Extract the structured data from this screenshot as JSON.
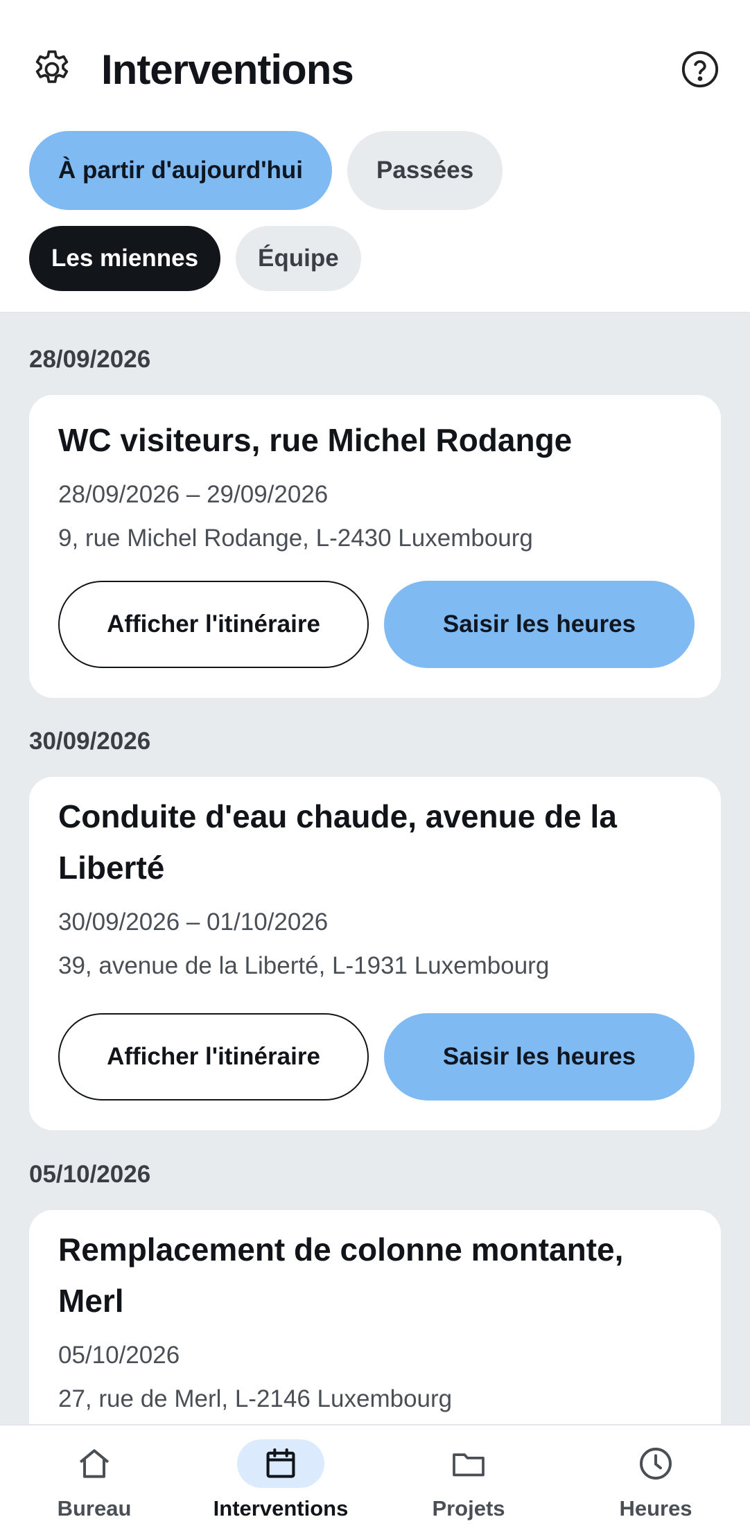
{
  "header": {
    "title": "Interventions",
    "settings_icon": "gear-icon",
    "help_icon": "help-circle-icon"
  },
  "filters": {
    "time": [
      {
        "label": "À partir d'aujourd'hui",
        "active": true
      },
      {
        "label": "Passées",
        "active": false
      }
    ],
    "scope": [
      {
        "label": "Les miennes",
        "active": true
      },
      {
        "label": "Équipe",
        "active": false
      }
    ]
  },
  "groups": [
    {
      "date": "28/09/2026",
      "card": {
        "title_lines": [
          "WC visiteurs, rue Michel Rodange"
        ],
        "dates": "28/09/2026 – 29/09/2026",
        "address": "9, rue Michel Rodange, L-2430 Luxembourg",
        "route_label": "Afficher l'itinéraire",
        "hours_label": "Saisir les heures"
      }
    },
    {
      "date": "30/09/2026",
      "card": {
        "title_lines": [
          "Conduite d'eau chaude, avenue de la",
          "Liberté"
        ],
        "dates": "30/09/2026 – 01/10/2026",
        "address": "39, avenue de la Liberté, L-1931 Luxembourg",
        "route_label": "Afficher l'itinéraire",
        "hours_label": "Saisir les heures"
      }
    },
    {
      "date": "05/10/2026",
      "card": {
        "title_lines": [
          "Remplacement de colonne montante,",
          "Merl"
        ],
        "dates": "05/10/2026",
        "address": "27, rue de Merl, L-2146 Luxembourg"
      }
    }
  ],
  "bottom_nav": [
    {
      "label": "Bureau",
      "icon": "home-icon",
      "active": false
    },
    {
      "label": "Interventions",
      "icon": "calendar-icon",
      "active": true
    },
    {
      "label": "Projets",
      "icon": "folder-icon",
      "active": false
    },
    {
      "label": "Heures",
      "icon": "clock-icon",
      "active": false
    }
  ],
  "colors": {
    "accent": "#7fbaf3",
    "dark_pill": "#121519",
    "background": "#e8ebee"
  }
}
